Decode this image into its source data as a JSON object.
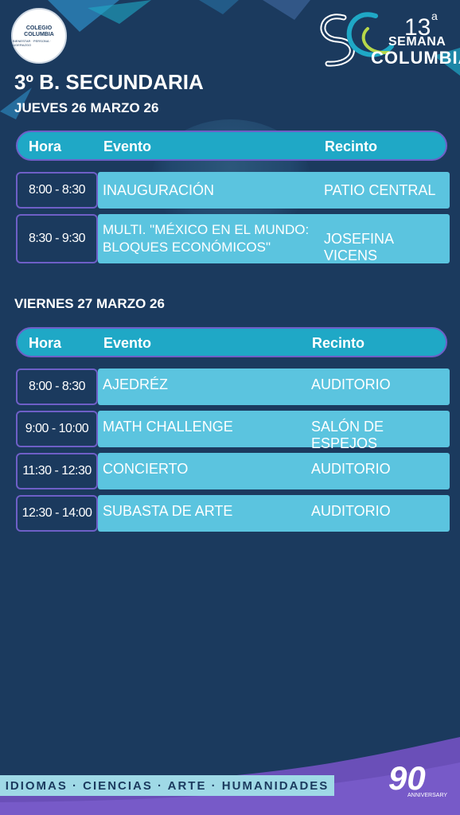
{
  "header": {
    "school_logo": {
      "line1": "COLEGIO",
      "line2": "COLUMBIA",
      "motto": "BIENESTAR · PERSONA · LIDERAZGO"
    },
    "event_logo": {
      "number": "13",
      "superscript": "a",
      "word1": "SEMANA",
      "word2": "COLUMBIA"
    },
    "title": "3º B. SECUNDARIA"
  },
  "days": [
    {
      "date": "JUEVES 26 MARZO 26",
      "columns": {
        "hora": "Hora",
        "evento": "Evento",
        "recinto": "Recinto"
      },
      "rows": [
        {
          "hora": "8:00 - 8:30",
          "evento": "INAUGURACIÓN",
          "recinto": "PATIO CENTRAL"
        },
        {
          "hora": "8:30 - 9:30",
          "evento_line1": "MULTI. \"MÉXICO EN EL MUNDO:",
          "evento_line2": "BLOQUES ECONÓMICOS\"",
          "recinto": "JOSEFINA VICENS"
        }
      ]
    },
    {
      "date": "VIERNES 27 MARZO 26",
      "columns": {
        "hora": "Hora",
        "evento": "Evento",
        "recinto": "Recinto"
      },
      "rows": [
        {
          "hora": "8:00 - 8:30",
          "evento": "AJEDRÉZ",
          "recinto": "AUDITORIO"
        },
        {
          "hora": "9:00 - 10:00",
          "evento": "MATH CHALLENGE",
          "recinto": "SALÓN DE ESPEJOS"
        },
        {
          "hora": "11:30 - 12:30",
          "evento": "CONCIERTO",
          "recinto": "AUDITORIO"
        },
        {
          "hora": "12:30 - 14:00",
          "evento": "SUBASTA DE ARTE",
          "recinto": "AUDITORIO"
        }
      ]
    }
  ],
  "footer": {
    "tagline": "IDIOMAS · CIENCIAS · ARTE · HUMANIDADES",
    "anniversary_number": "90",
    "anniversary_label": "ANNIVERSARY"
  },
  "colors": {
    "background": "#1b3a5e",
    "header_bar": "#1fa8c6",
    "cell": "#5bc4df",
    "outline": "#6e5fc7",
    "footer_wave": "#6a4fb8"
  }
}
